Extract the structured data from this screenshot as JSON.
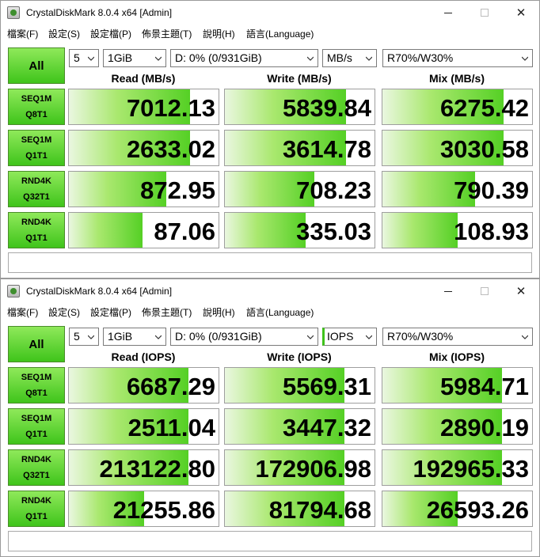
{
  "windows": [
    {
      "title": "CrystalDiskMark 8.0.4 x64 [Admin]",
      "menu": [
        "檔案(F)",
        "設定(S)",
        "設定檔(P)",
        "佈景主題(T)",
        "說明(H)",
        "語言(Language)"
      ],
      "all_label": "All",
      "selectors": {
        "count": "5",
        "size": "1GiB",
        "drive": "D: 0% (0/931GiB)",
        "unit": "MB/s",
        "mix": "R70%/W30%"
      },
      "headers": [
        "Read (MB/s)",
        "Write (MB/s)",
        "Mix (MB/s)"
      ],
      "rows": [
        {
          "label1": "SEQ1M",
          "label2": "Q8T1",
          "values": [
            "7012.13",
            "5839.84",
            "6275.42"
          ],
          "fill": [
            0.81,
            0.81,
            0.81
          ]
        },
        {
          "label1": "SEQ1M",
          "label2": "Q1T1",
          "values": [
            "2633.02",
            "3614.78",
            "3030.58"
          ],
          "fill": [
            0.81,
            0.81,
            0.81
          ]
        },
        {
          "label1": "RND4K",
          "label2": "Q32T1",
          "values": [
            "872.95",
            "708.23",
            "790.39"
          ],
          "fill": [
            0.65,
            0.6,
            0.62
          ]
        },
        {
          "label1": "RND4K",
          "label2": "Q1T1",
          "values": [
            "87.06",
            "335.03",
            "108.93"
          ],
          "fill": [
            0.49,
            0.54,
            0.5
          ]
        }
      ],
      "comment": ""
    },
    {
      "title": "CrystalDiskMark 8.0.4 x64 [Admin]",
      "menu": [
        "檔案(F)",
        "設定(S)",
        "設定檔(P)",
        "佈景主題(T)",
        "說明(H)",
        "語言(Language)"
      ],
      "all_label": "All",
      "selectors": {
        "count": "5",
        "size": "1GiB",
        "drive": "D: 0% (0/931GiB)",
        "unit": "IOPS",
        "mix": "R70%/W30%"
      },
      "headers": [
        "Read (IOPS)",
        "Write (IOPS)",
        "Mix (IOPS)"
      ],
      "rows": [
        {
          "label1": "SEQ1M",
          "label2": "Q8T1",
          "values": [
            "6687.29",
            "5569.31",
            "5984.71"
          ],
          "fill": [
            0.8,
            0.8,
            0.8
          ]
        },
        {
          "label1": "SEQ1M",
          "label2": "Q1T1",
          "values": [
            "2511.04",
            "3447.32",
            "2890.19"
          ],
          "fill": [
            0.8,
            0.8,
            0.8
          ]
        },
        {
          "label1": "RND4K",
          "label2": "Q32T1",
          "values": [
            "213122.80",
            "172906.98",
            "192965.33"
          ],
          "fill": [
            0.8,
            0.8,
            0.8
          ]
        },
        {
          "label1": "RND4K",
          "label2": "Q1T1",
          "values": [
            "21255.86",
            "81794.68",
            "26593.26"
          ],
          "fill": [
            0.5,
            0.8,
            0.5
          ]
        }
      ],
      "comment": ""
    }
  ],
  "colors": {
    "accent_green": "#3fc41b",
    "bar_green": "#55d025"
  }
}
